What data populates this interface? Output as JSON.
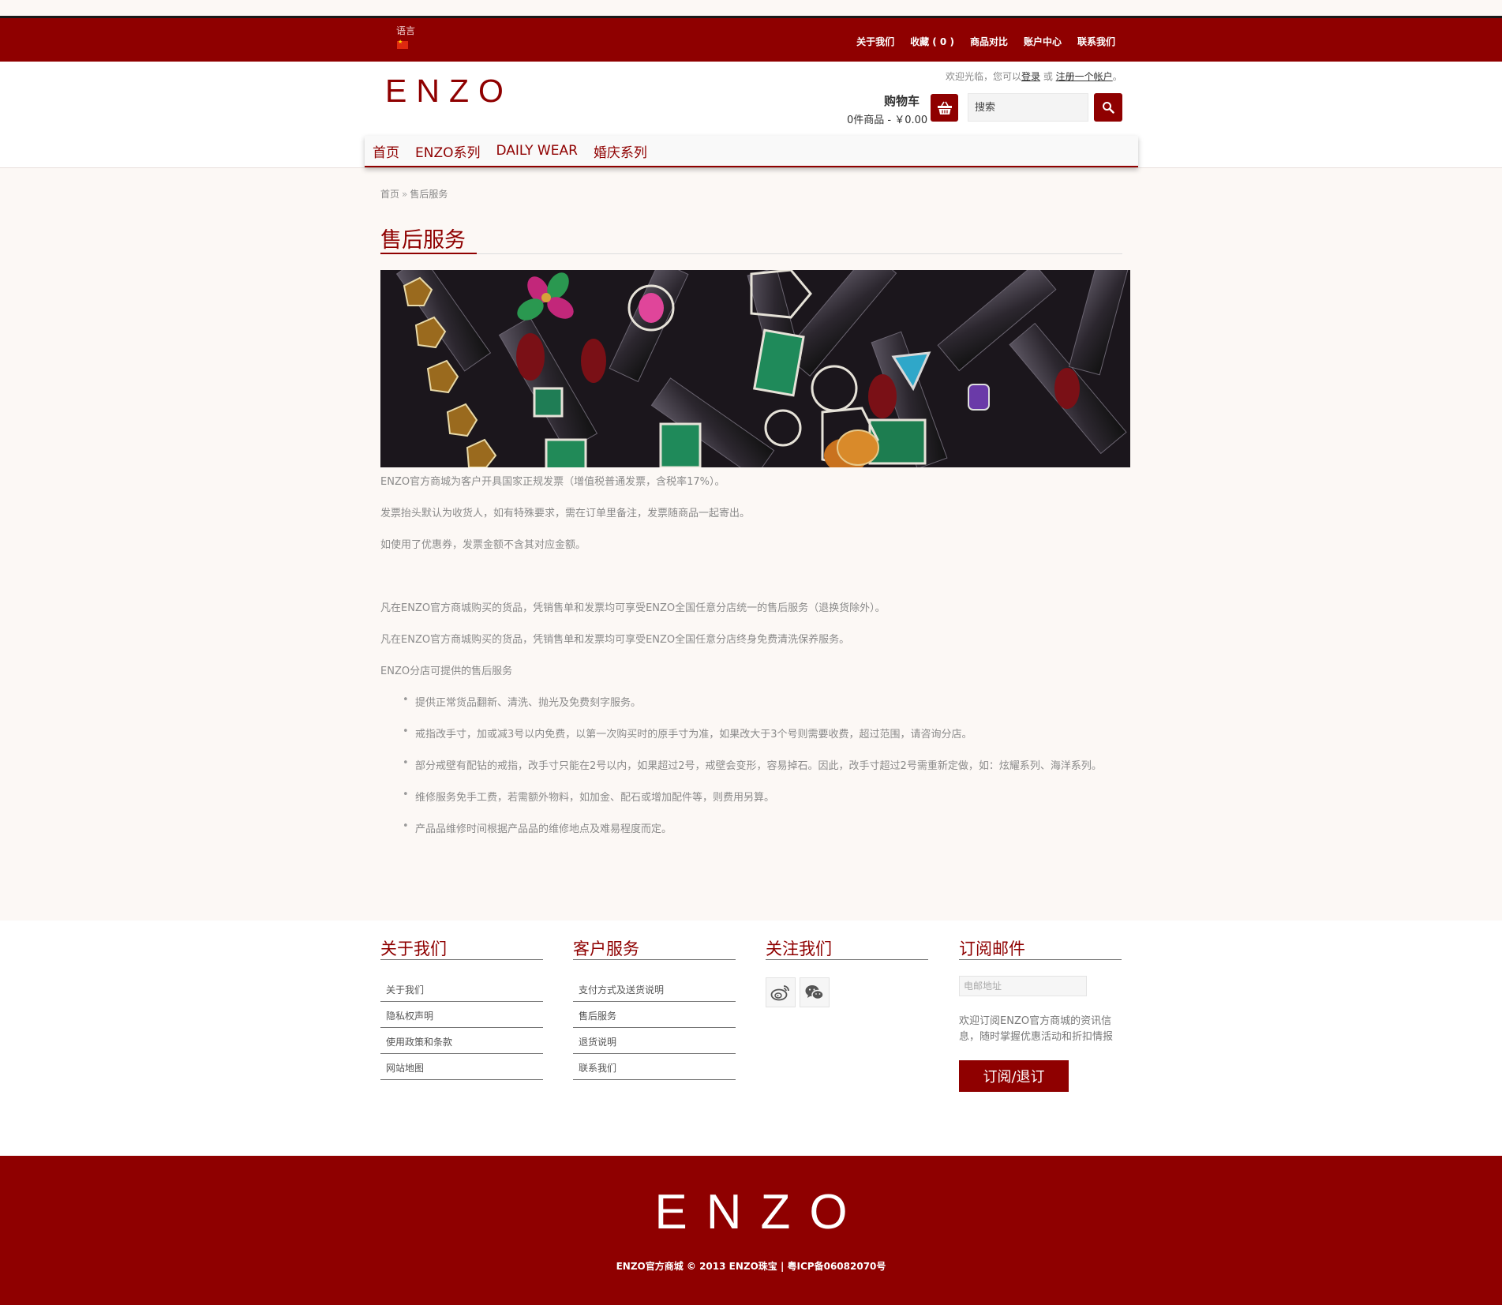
{
  "topbar": {
    "language_label": "语言",
    "links": [
      "关于我们",
      "收藏 ( 0 )",
      "商品对比",
      "账户中心",
      "联系我们"
    ]
  },
  "header": {
    "logo": "ENZO",
    "welcome_prefix": "欢迎光临，您可以",
    "login": "登录",
    "or": " 或 ",
    "register": "注册一个帐户",
    "welcome_suffix": "。",
    "cart_title": "购物车",
    "cart_summary": "0件商品 - ￥0.00",
    "search_placeholder": "搜索"
  },
  "nav": {
    "items": [
      "首页",
      "ENZO系列",
      "DAILY WEAR",
      "婚庆系列"
    ]
  },
  "breadcrumb": {
    "home": "首页",
    "separator": "»",
    "current": "售后服务"
  },
  "content": {
    "title": "售后服务",
    "paragraphs": [
      "ENZO官方商城为客户开具国家正规发票（增值税普通发票，含税率17%）。",
      "发票抬头默认为收货人，如有特殊要求，需在订单里备注，发票随商品一起寄出。",
      "如使用了优惠券，发票金额不含其对应金额。",
      "凡在ENZO官方商城购买的货品，凭销售单和发票均可享受ENZO全国任意分店统一的售后服务（退换货除外）。",
      "凡在ENZO官方商城购买的货品，凭销售单和发票均可享受ENZO全国任意分店终身免费清洗保养服务。",
      "ENZO分店可提供的售后服务"
    ],
    "bullets": [
      "提供正常货品翻新、清洗、抛光及免费刻字服务。",
      "戒指改手寸，加或减3号以内免费，以第一次购买时的原手寸为准，如果改大于3个号则需要收费，超过范围，请咨询分店。",
      "部分戒壁有配钻的戒指，改手寸只能在2号以内，如果超过2号，戒壁会变形，容易掉石。因此，改手寸超过2号需重新定做，如：炫耀系列、海洋系列。",
      "维修服务免手工费，若需额外物料，如加金、配石或增加配件等，则费用另算。",
      "产品品维修时间根据产品品的维修地点及难易程度而定。"
    ]
  },
  "footer": {
    "about": {
      "title": "关于我们",
      "links": [
        "关于我们",
        "隐私权声明",
        "使用政策和条款",
        "网站地图"
      ]
    },
    "service": {
      "title": "客户服务",
      "links": [
        "支付方式及送货说明",
        "售后服务",
        "退货说明",
        "联系我们"
      ]
    },
    "follow": {
      "title": "关注我们",
      "icons": [
        "weibo-icon",
        "wechat-icon"
      ]
    },
    "newsletter": {
      "title": "订阅邮件",
      "email_placeholder": "电邮地址",
      "text": "欢迎订阅ENZO官方商城的资讯信息，随时掌握优惠活动和折扣情报",
      "button": "订阅/退订"
    },
    "logo": "ENZO",
    "copyright": "ENZO官方商城 © 2013 ENZO珠宝 | 粤ICP备06082070号"
  },
  "colors": {
    "brand": "#8f0000",
    "background": "#fcf8f5"
  }
}
